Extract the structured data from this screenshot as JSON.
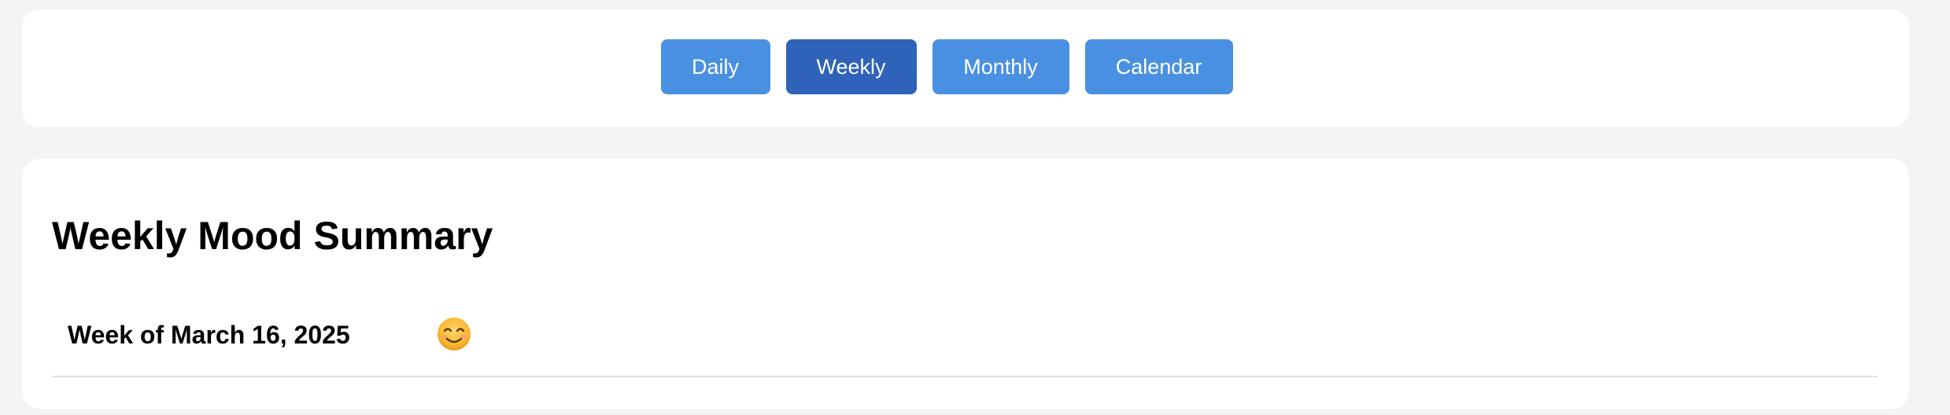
{
  "nav": {
    "tabs": [
      {
        "label": "Daily",
        "active": false
      },
      {
        "label": "Weekly",
        "active": true
      },
      {
        "label": "Monthly",
        "active": false
      },
      {
        "label": "Calendar",
        "active": false
      }
    ]
  },
  "summary": {
    "title": "Weekly Mood Summary",
    "entries": [
      {
        "week_label": "Week of March 16, 2025",
        "mood_icon": "smiling-face-icon"
      }
    ]
  },
  "colors": {
    "page_background": "#f4f4f4",
    "card_background": "#ffffff",
    "tab_background": "#4a90e2",
    "tab_active_background": "#2f62b9",
    "tab_text": "#ffffff",
    "divider": "#e2e2e2"
  }
}
